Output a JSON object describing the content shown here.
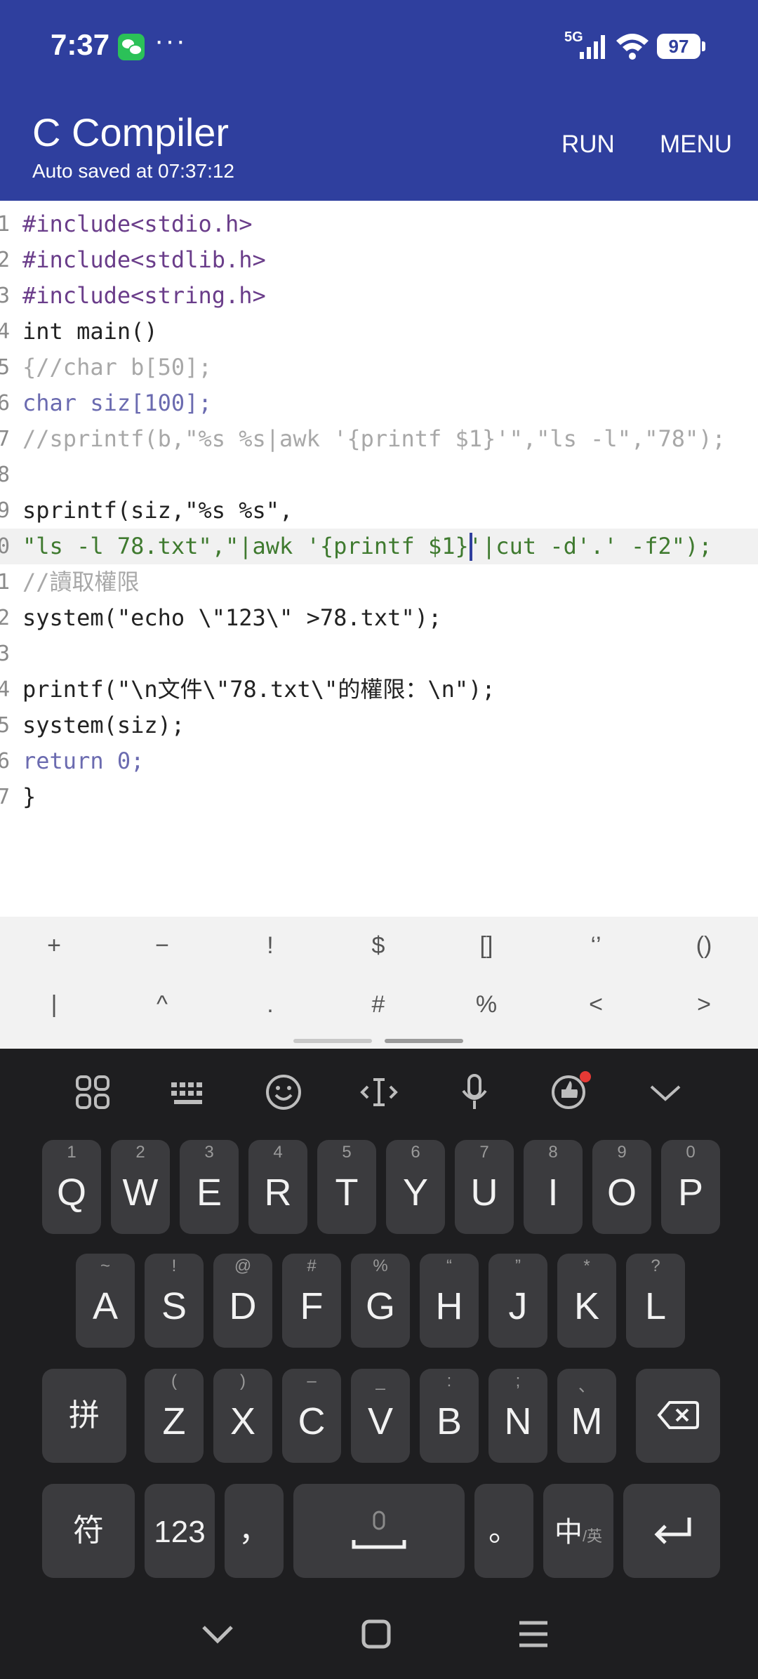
{
  "status_bar": {
    "time": "7:37",
    "dots": "···",
    "network": "5G",
    "battery": "97"
  },
  "app_bar": {
    "title": "C Compiler",
    "subtitle": "Auto saved at 07:37:12",
    "run_label": "RUN",
    "menu_label": "MENU"
  },
  "editor": {
    "line_numbers": [
      "1",
      "2",
      "3",
      "4",
      "5",
      "6",
      "7",
      "8",
      "9",
      "0",
      "1",
      "2",
      "3",
      "4",
      "5",
      "6",
      "7"
    ],
    "lines": [
      "#include<stdio.h>",
      "#include<stdlib.h>",
      "#include<string.h>",
      "int main()",
      "{//char b[50];",
      "char siz[100];",
      "//sprintf(b,\"%s %s|awk '{printf $1}'\",\"ls -l\",\"78\");",
      "",
      "sprintf(siz,\"%s %s\",",
      "\"ls -l 78.txt\",\"|awk '{printf $1}'|cut -d'.' -f2\");",
      "//讀取權限",
      "system(\"echo \\\"123\\\" >78.txt\");",
      "",
      "printf(\"\\n文件\\\"78.txt\\\"的權限：\\n\");",
      "system(siz);",
      "return 0;",
      "}"
    ]
  },
  "symbol_bar": {
    "row1": [
      "+",
      "−",
      "!",
      "$",
      "[]",
      "‘’",
      "()"
    ],
    "row2": [
      "|",
      "^",
      ".",
      "#",
      "%",
      "<",
      ">"
    ]
  },
  "keyboard": {
    "row1": [
      {
        "key": "Q",
        "hint": "1"
      },
      {
        "key": "W",
        "hint": "2"
      },
      {
        "key": "E",
        "hint": "3"
      },
      {
        "key": "R",
        "hint": "4"
      },
      {
        "key": "T",
        "hint": "5"
      },
      {
        "key": "Y",
        "hint": "6"
      },
      {
        "key": "U",
        "hint": "7"
      },
      {
        "key": "I",
        "hint": "8"
      },
      {
        "key": "O",
        "hint": "9"
      },
      {
        "key": "P",
        "hint": "0"
      }
    ],
    "row2": [
      {
        "key": "A",
        "hint": "~"
      },
      {
        "key": "S",
        "hint": "!"
      },
      {
        "key": "D",
        "hint": "@"
      },
      {
        "key": "F",
        "hint": "#"
      },
      {
        "key": "G",
        "hint": "%"
      },
      {
        "key": "H",
        "hint": "“"
      },
      {
        "key": "J",
        "hint": "”"
      },
      {
        "key": "K",
        "hint": "*"
      },
      {
        "key": "L",
        "hint": "?"
      }
    ],
    "row3": [
      {
        "key": "Z",
        "hint": "("
      },
      {
        "key": "X",
        "hint": ")"
      },
      {
        "key": "C",
        "hint": "–"
      },
      {
        "key": "V",
        "hint": "_"
      },
      {
        "key": "B",
        "hint": ":"
      },
      {
        "key": "N",
        "hint": ";"
      },
      {
        "key": "M",
        "hint": "、"
      }
    ],
    "pinyin_label": "拼",
    "symbols_label": "符",
    "numbers_label": "123",
    "comma_label": "，",
    "period_label": "。",
    "lang_label": "中",
    "lang_sub_label": "/英"
  },
  "colors": {
    "app_bar": "#2f3f9e",
    "keyboard_bg": "#1e1e20",
    "key_bg": "#3b3b3e",
    "notification_dot": "#e53935"
  }
}
